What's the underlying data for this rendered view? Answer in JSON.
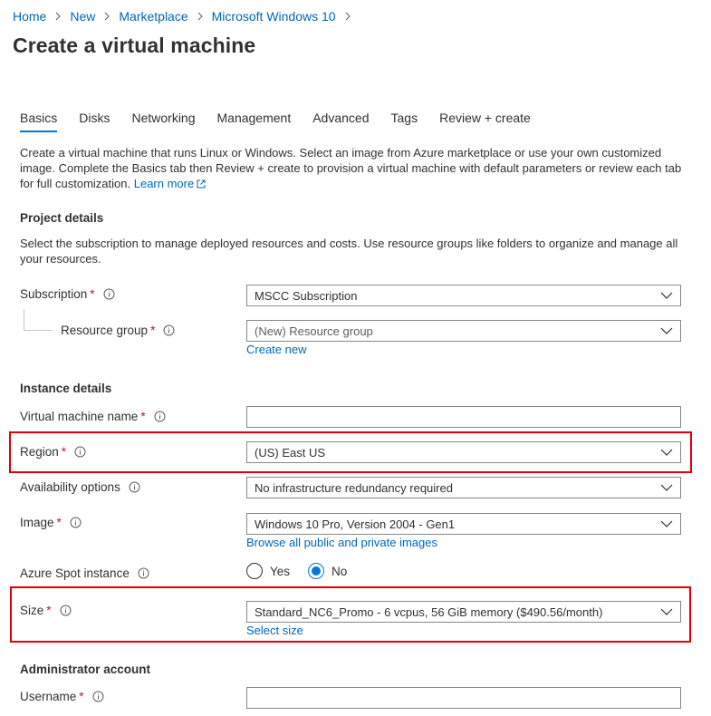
{
  "breadcrumb": [
    "Home",
    "New",
    "Marketplace",
    "Microsoft Windows 10"
  ],
  "page_title": "Create a virtual machine",
  "tabs": [
    {
      "label": "Basics",
      "active": true
    },
    {
      "label": "Disks"
    },
    {
      "label": "Networking"
    },
    {
      "label": "Management"
    },
    {
      "label": "Advanced"
    },
    {
      "label": "Tags"
    },
    {
      "label": "Review + create"
    }
  ],
  "intro": {
    "text": "Create a virtual machine that runs Linux or Windows. Select an image from Azure marketplace or use your own customized image. Complete the Basics tab then Review + create to provision a virtual machine with default parameters or review each tab for full customization.",
    "learn_more": "Learn more"
  },
  "project_details": {
    "title": "Project details",
    "description": "Select the subscription to manage deployed resources and costs. Use resource groups like folders to organize and manage all your resources.",
    "subscription": {
      "label": "Subscription",
      "value": "MSCC Subscription"
    },
    "resource_group": {
      "label": "Resource group",
      "placeholder": "(New) Resource group",
      "create_new": "Create new"
    }
  },
  "instance_details": {
    "title": "Instance details",
    "vm_name": {
      "label": "Virtual machine name",
      "value": ""
    },
    "region": {
      "label": "Region",
      "value": "(US) East US"
    },
    "availability": {
      "label": "Availability options",
      "value": "No infrastructure redundancy required"
    },
    "image": {
      "label": "Image",
      "value": "Windows 10 Pro, Version 2004 - Gen1",
      "browse_link": "Browse all public and private images"
    },
    "spot": {
      "label": "Azure Spot instance",
      "options": [
        "Yes",
        "No"
      ],
      "selected": "No"
    },
    "size": {
      "label": "Size",
      "value": "Standard_NC6_Promo - 6 vcpus, 56 GiB memory ($490.56/month)",
      "select_link": "Select size"
    }
  },
  "admin_account": {
    "title": "Administrator account",
    "username": {
      "label": "Username",
      "value": ""
    }
  },
  "required_marker": "*",
  "colors": {
    "link": "#0067b8",
    "accent": "#0078d4",
    "required": "#a4262c",
    "highlight": "#e0000b"
  },
  "icons": {
    "info": "info-icon",
    "caret": "chevron-down-icon",
    "external": "external-link-icon",
    "separator": "chevron-right-icon"
  }
}
